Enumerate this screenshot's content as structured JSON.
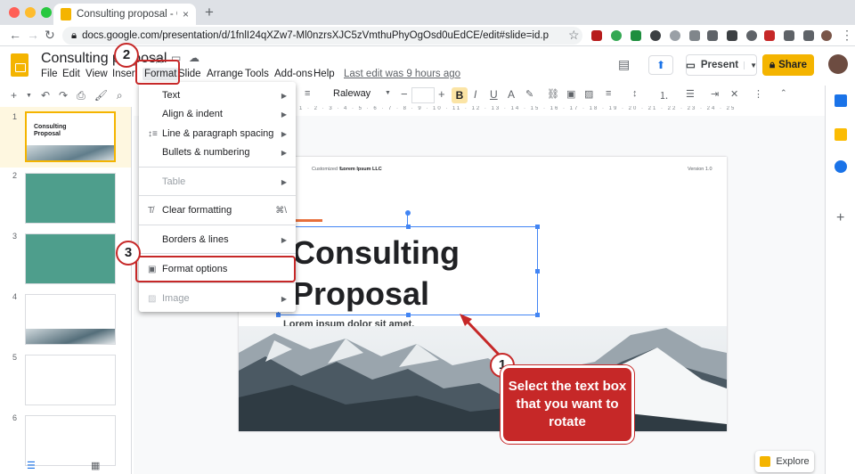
{
  "browser": {
    "tab_title": "Consulting proposal - Google Slides",
    "tab_close": "×",
    "new_tab": "+",
    "url": "docs.google.com/presentation/d/1fnlI24qXZw7-Ml0nzrsXJC5zVmthuPhyOgOsd0uEdCE/edit#slide=id.p"
  },
  "doc": {
    "title": "Consulting proposal",
    "menus": [
      "File",
      "Edit",
      "View",
      "Insert",
      "Format",
      "Slide",
      "Arrange",
      "Tools",
      "Add-ons",
      "Help"
    ],
    "last_edit": "Last edit was 9 hours ago",
    "present_label": "Present",
    "share_label": "Share"
  },
  "toolbar": {
    "font": "Raleway",
    "bold": "B",
    "ruler": "1 · 2 · 3 · 4 · 5 · 6 · 7 · 8 · 9 · 10 · 11 · 12 · 13 · 14 · 15 · 16 · 17 · 18 · 19 · 20 · 21 · 22 · 23 · 24 · 25"
  },
  "filmstrip": {
    "numbers": [
      "1",
      "2",
      "3",
      "4",
      "5",
      "6"
    ],
    "thumb1_title": "Consulting Proposal"
  },
  "slide": {
    "customized_for": "Customized for",
    "customer": "Lorem Ipsum LLC",
    "version": "Version 1.0",
    "title_line1": "Consulting",
    "title_line2": "Proposal",
    "subtitle": "Lorem ipsum dolor sit amet."
  },
  "format_menu": {
    "items": [
      {
        "label": "Text",
        "submenu": true
      },
      {
        "label": "Align & indent",
        "submenu": true
      },
      {
        "label": "Line & paragraph spacing",
        "submenu": true
      },
      {
        "label": "Bullets & numbering",
        "submenu": true
      },
      {
        "label": "Table",
        "submenu": true,
        "disabled": true
      },
      {
        "label": "Clear formatting",
        "shortcut": "⌘\\"
      },
      {
        "label": "Borders & lines",
        "submenu": true
      },
      {
        "label": "Format options"
      },
      {
        "label": "Image",
        "submenu": true,
        "disabled": true
      }
    ]
  },
  "annotations": {
    "step1": "1",
    "step2": "2",
    "step3": "3",
    "callout": "Select the text box that you want to rotate",
    "accent_color": "#c62828"
  },
  "explore_label": "Explore"
}
